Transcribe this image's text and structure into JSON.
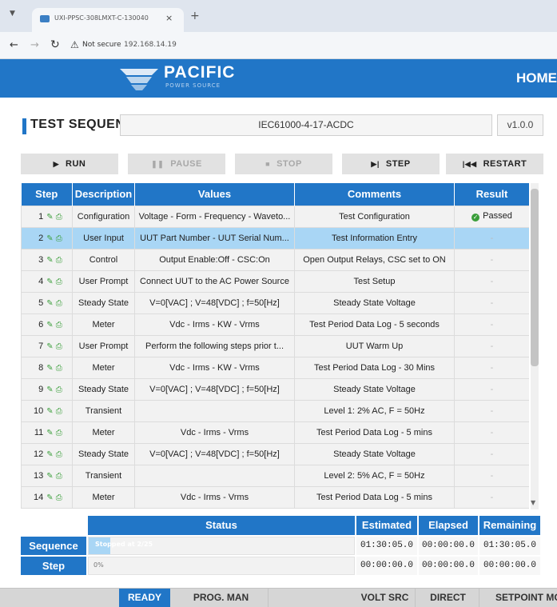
{
  "browser": {
    "tab_title": "UXI-PPSC-308LMXT-C-130040",
    "url": "192.168.14.19",
    "security_label": "Not secure"
  },
  "header": {
    "logo_text": "PACIFIC",
    "logo_subtext": "POWER SOURCE",
    "home_label": "HOME"
  },
  "sequence": {
    "title": "TEST SEQUENCE",
    "name": "IEC61000-4-17-ACDC",
    "version": "v1.0.0"
  },
  "controls": {
    "run": "RUN",
    "pause": "PAUSE",
    "stop": "STOP",
    "step": "STEP",
    "restart": "RESTART"
  },
  "table": {
    "headers": [
      "Step",
      "Description",
      "Values",
      "Comments",
      "Result"
    ],
    "rows": [
      {
        "step": "1",
        "description": "Configuration",
        "values": "Voltage - Form - Frequency - Waveto...",
        "comments": "Test Configuration",
        "result": "Passed"
      },
      {
        "step": "2",
        "description": "User Input",
        "values": "UUT Part Number - UUT Serial Num...",
        "comments": "Test Information Entry",
        "result": "-"
      },
      {
        "step": "3",
        "description": "Control",
        "values": "Output Enable:Off - CSC:On",
        "comments": "Open Output Relays, CSC set to ON",
        "result": "-"
      },
      {
        "step": "4",
        "description": "User Prompt",
        "values": "Connect UUT to the AC Power Source",
        "comments": "Test Setup",
        "result": "-"
      },
      {
        "step": "5",
        "description": "Steady State",
        "values": "V=0[VAC] ; V=48[VDC] ; f=50[Hz]",
        "comments": "Steady State Voltage",
        "result": "-"
      },
      {
        "step": "6",
        "description": "Meter",
        "values": "Vdc - Irms - KW - Vrms",
        "comments": "Test Period Data Log - 5 seconds",
        "result": "-"
      },
      {
        "step": "7",
        "description": "User Prompt",
        "values": "Perform the following steps prior t...",
        "comments": "UUT Warm Up",
        "result": "-"
      },
      {
        "step": "8",
        "description": "Meter",
        "values": "Vdc - Irms - KW - Vrms",
        "comments": "Test Period Data Log - 30 Mins",
        "result": "-"
      },
      {
        "step": "9",
        "description": "Steady State",
        "values": "V=0[VAC] ; V=48[VDC] ; f=50[Hz]",
        "comments": "Steady State Voltage",
        "result": "-"
      },
      {
        "step": "10",
        "description": "Transient",
        "values": "",
        "comments": "Level 1: 2% AC, F = 50Hz",
        "result": "-"
      },
      {
        "step": "11",
        "description": "Meter",
        "values": "Vdc - Irms - Vrms",
        "comments": "Test Period Data Log - 5 mins",
        "result": "-"
      },
      {
        "step": "12",
        "description": "Steady State",
        "values": "V=0[VAC] ; V=48[VDC] ; f=50[Hz]",
        "comments": "Steady State Voltage",
        "result": "-"
      },
      {
        "step": "13",
        "description": "Transient",
        "values": "",
        "comments": "Level 2: 5% AC, F = 50Hz",
        "result": "-"
      },
      {
        "step": "14",
        "description": "Meter",
        "values": "Vdc - Irms - Vrms",
        "comments": "Test Period Data Log - 5 mins",
        "result": "-"
      }
    ],
    "selected_step": "2"
  },
  "status": {
    "headers": {
      "status": "Status",
      "estimated": "Estimated",
      "elapsed": "Elapsed",
      "remaining": "Remaining"
    },
    "sequence": {
      "label": "Sequence",
      "progress_text": "Stopped at 2/25",
      "progress_fraction": 0.08,
      "estimated": "01:30:05.0",
      "elapsed": "00:00:00.0",
      "remaining": "01:30:05.0"
    },
    "step": {
      "label": "Step",
      "progress_text": "0%",
      "progress_fraction": 0,
      "estimated": "00:00:00.0",
      "elapsed": "00:00:00.0",
      "remaining": "00:00:00.0"
    }
  },
  "footer": {
    "state": "READY",
    "program_mode": "PROG. MAN",
    "source_mode": "VOLT SRC",
    "coupling": "DIRECT",
    "setpoint": "SETPOINT MO"
  },
  "colors": {
    "accent": "#2176c7",
    "selected_row": "#a9d6f5",
    "passed": "#3a9e3a"
  }
}
